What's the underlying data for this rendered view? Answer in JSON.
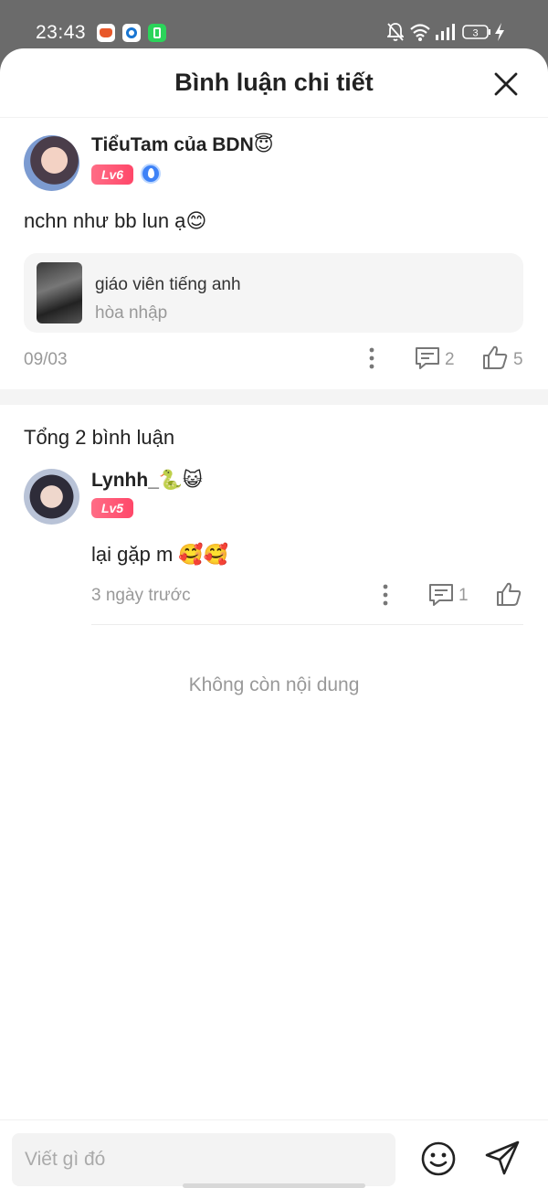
{
  "status_bar": {
    "time": "23:43",
    "battery": "3",
    "icons": [
      "orange-app-icon",
      "blue-app-icon",
      "green-app-icon",
      "bell-off-icon",
      "wifi-icon",
      "signal-icon",
      "battery-icon",
      "charging-icon"
    ]
  },
  "header": {
    "title": "Bình luận chi tiết",
    "close_icon": "close-icon"
  },
  "main_comment": {
    "username": "TiểuTam của BDN😇",
    "level": "Lv6",
    "text": "nchn như bb lun ạ😊",
    "topic": {
      "title": "giáo viên tiếng anh",
      "subtitle": "hòa nhập"
    },
    "date": "09/03",
    "reply_count": "2",
    "like_count": "5"
  },
  "replies_section": {
    "total_label": "Tổng 2 bình luận",
    "replies": [
      {
        "username": "Lynhh_🐍😺",
        "level": "Lv5",
        "text": "lại gặp m 🥰🥰",
        "time": "3 ngày trước",
        "reply_count": "1"
      }
    ],
    "end_text": "Không còn nội dung"
  },
  "composer": {
    "placeholder": "Viết gì đó",
    "emoji_icon": "smiley-icon",
    "send_icon": "send-icon"
  },
  "colors": {
    "level_badge": "#ff5a78",
    "muted_text": "#999999",
    "badge_blue": "#3e82f7"
  }
}
